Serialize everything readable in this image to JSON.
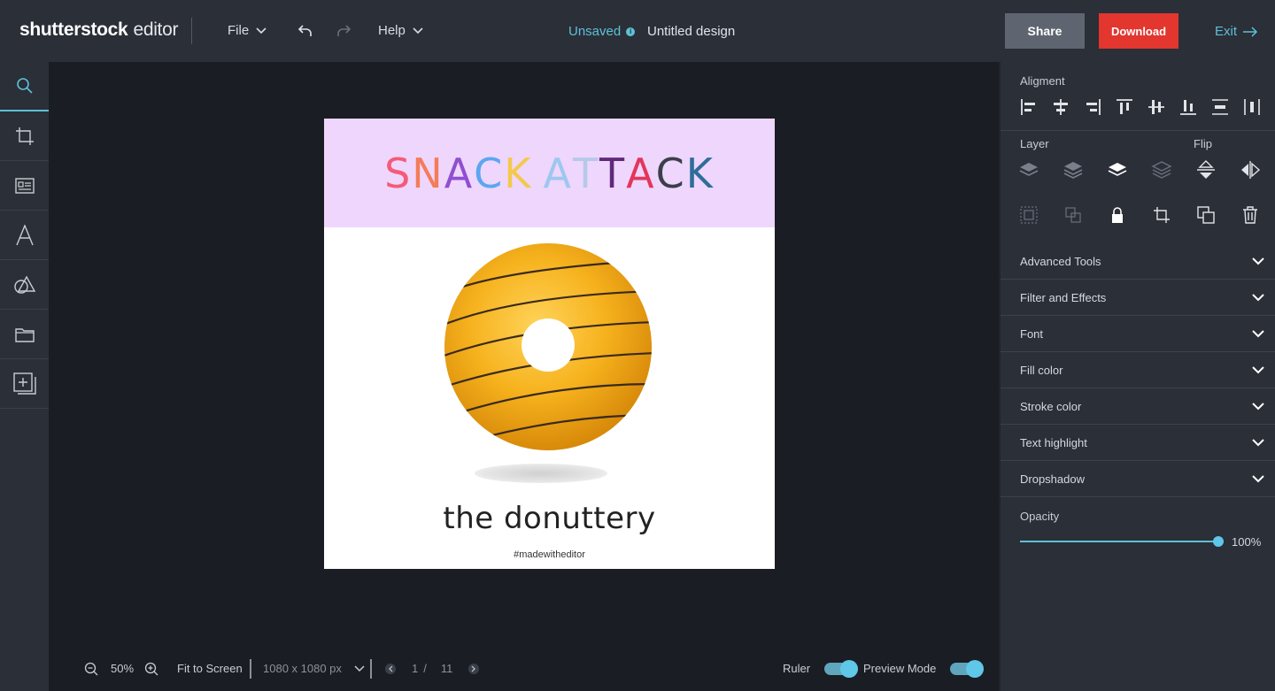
{
  "header": {
    "brand_main": "shutterstock",
    "brand_sub": "editor",
    "file_label": "File",
    "help_label": "Help",
    "status": "Unsaved",
    "doc_title": "Untitled design",
    "share_label": "Share",
    "download_label": "Download",
    "exit_label": "Exit",
    "colors": {
      "accent": "#5fc0d6",
      "download": "#e2362f",
      "share": "#5f6570"
    }
  },
  "sidebar": {
    "tools": [
      {
        "icon": "search-icon"
      },
      {
        "icon": "crop-icon"
      },
      {
        "icon": "template-icon"
      },
      {
        "icon": "text-icon"
      },
      {
        "icon": "shapes-icon"
      },
      {
        "icon": "folder-icon"
      },
      {
        "icon": "add-page-icon"
      }
    ]
  },
  "design": {
    "headline_letters": [
      {
        "ch": "S",
        "color": "#f35b78"
      },
      {
        "ch": "N",
        "color": "#f47c5a"
      },
      {
        "ch": "A",
        "color": "#8f4fd1"
      },
      {
        "ch": "C",
        "color": "#5aa7ef"
      },
      {
        "ch": "K",
        "color": "#f3c94c"
      },
      {
        "ch": " ",
        "color": "#000000"
      },
      {
        "ch": "A",
        "color": "#9ec7f0"
      },
      {
        "ch": "T",
        "color": "#b7c9ea"
      },
      {
        "ch": "T",
        "color": "#5f2a7a"
      },
      {
        "ch": "A",
        "color": "#e2365c"
      },
      {
        "ch": "C",
        "color": "#3a3f4a"
      },
      {
        "ch": "K",
        "color": "#2f6d9a"
      }
    ],
    "subtitle": "the donuttery",
    "hashtag": "#madewitheditor",
    "banner_color": "#efd6fc"
  },
  "bottom": {
    "zoom": "50%",
    "fit_label": "Fit to Screen",
    "size": "1080 x 1080 px",
    "page_current": "1",
    "page_sep": "/",
    "page_total": "11",
    "ruler_label": "Ruler",
    "preview_label": "Preview Mode"
  },
  "panel": {
    "alignment_label": "Aligment",
    "layer_label": "Layer",
    "flip_label": "Flip",
    "sections": [
      "Advanced Tools",
      "Filter and Effects",
      "Font",
      "Fill color",
      "Stroke color",
      "Text highlight",
      "Dropshadow"
    ],
    "opacity_label": "Opacity",
    "opacity_value": "100%",
    "opacity_fraction": 1.0
  }
}
